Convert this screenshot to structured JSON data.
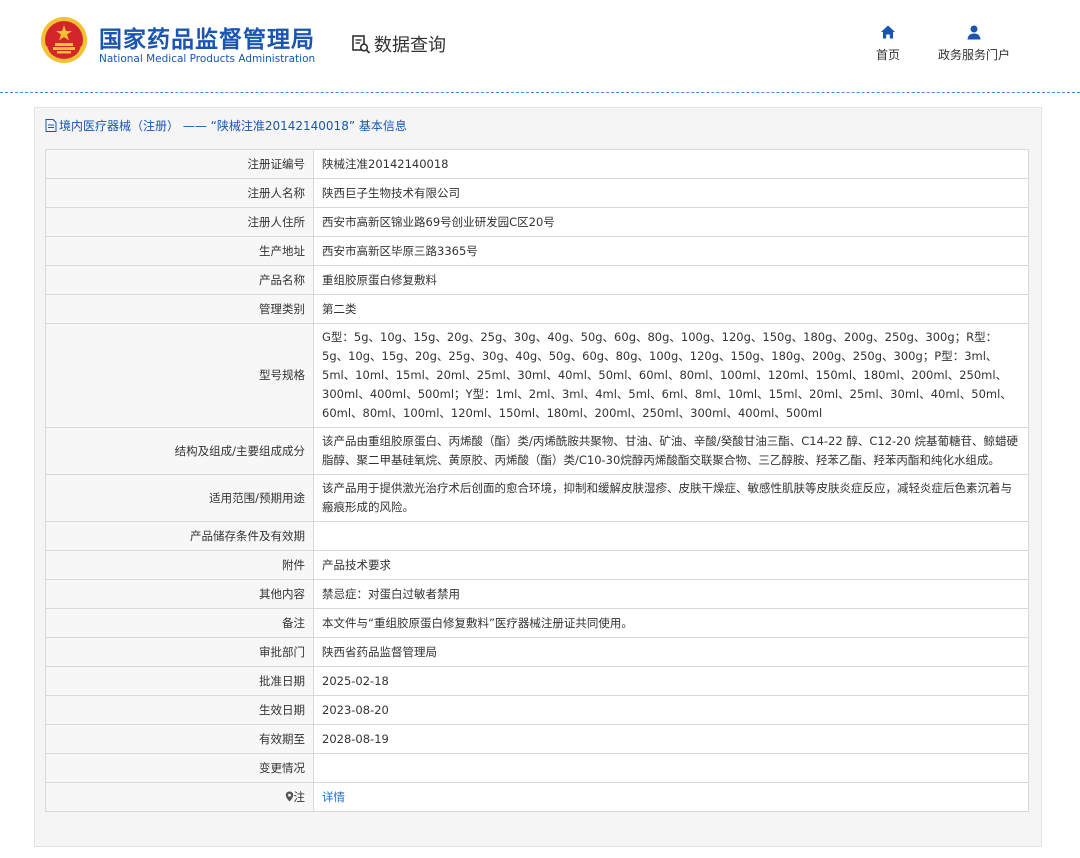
{
  "header": {
    "brand_cn": "国家药品监督管理局",
    "brand_en": "National Medical Products Administration",
    "emblem_icon": "national-emblem-icon",
    "query_icon": "document-search-icon",
    "query_label": "数据查询",
    "nav": [
      {
        "label": "首页",
        "icon": "home-icon"
      },
      {
        "label": "政务服务门户",
        "icon": "user-icon"
      }
    ]
  },
  "colors": {
    "brand_blue": "#1a56b0",
    "link_blue": "#1a6fd0",
    "panel_bg": "#f5f5f5",
    "emblem_red": "#d3252b",
    "emblem_gold": "#f2c230"
  },
  "panel": {
    "title": "境内医疗器械（注册） —— “陕械注准20142140018” 基本信息",
    "title_icon": "document-icon"
  },
  "rows": {
    "reg_no": {
      "label": "注册证编号",
      "value": "陕械注准20142140018"
    },
    "registrant": {
      "label": "注册人名称",
      "value": "陕西巨子生物技术有限公司"
    },
    "address": {
      "label": "注册人住所",
      "value": "西安市高新区锦业路69号创业研发园C区20号"
    },
    "mfg_address": {
      "label": "生产地址",
      "value": "西安市高新区毕原三路3365号"
    },
    "product_name": {
      "label": "产品名称",
      "value": "重组胶原蛋白修复敷料"
    },
    "category": {
      "label": "管理类别",
      "value": "第二类"
    },
    "model": {
      "label": "型号规格",
      "value": "G型：5g、10g、15g、20g、25g、30g、40g、50g、60g、80g、100g、120g、150g、180g、200g、250g、300g；R型：5g、10g、15g、20g、25g、30g、40g、50g、60g、80g、100g、120g、150g、180g、200g、250g、300g；P型：3ml、5ml、10ml、15ml、20ml、25ml、30ml、40ml、50ml、60ml、80ml、100ml、120ml、150ml、180ml、200ml、250ml、300ml、400ml、500ml；Y型：1ml、2ml、3ml、4ml、5ml、6ml、8ml、10ml、15ml、20ml、25ml、30ml、40ml、50ml、60ml、80ml、100ml、120ml、150ml、180ml、200ml、250ml、300ml、400ml、500ml"
    },
    "composition": {
      "label": "结构及组成/主要组成成分",
      "value": "该产品由重组胶原蛋白、丙烯酸（酯）类/丙烯酰胺共聚物、甘油、矿油、辛酸/癸酸甘油三酯、C14-22 醇、C12-20 烷基葡糖苷、鲸蜡硬脂醇、聚二甲基硅氧烷、黄原胶、丙烯酸（酯）类/C10-30烷醇丙烯酸酯交联聚合物、三乙醇胺、羟苯乙酯、羟苯丙酯和纯化水组成。"
    },
    "usage": {
      "label": "适用范围/预期用途",
      "value": "该产品用于提供激光治疗术后创面的愈合环境，抑制和缓解皮肤湿疹、皮肤干燥症、敏感性肌肤等皮肤炎症反应，减轻炎症后色素沉着与瘢痕形成的风险。"
    },
    "storage": {
      "label": "产品储存条件及有效期",
      "value": ""
    },
    "attachment": {
      "label": "附件",
      "value": "产品技术要求"
    },
    "other": {
      "label": "其他内容",
      "value": "禁忌症：对蛋白过敏者禁用"
    },
    "remark": {
      "label": "备注",
      "value": "本文件与“重组胶原蛋白修复敷料”医疗器械注册证共同使用。"
    },
    "approver": {
      "label": "审批部门",
      "value": "陕西省药品监督管理局"
    },
    "approval_date": {
      "label": "批准日期",
      "value": "2025-02-18"
    },
    "effective_date": {
      "label": "生效日期",
      "value": "2023-08-20"
    },
    "expiry_date": {
      "label": "有效期至",
      "value": "2028-08-19"
    },
    "changes": {
      "label": "变更情况",
      "value": ""
    },
    "note": {
      "label": "注",
      "icon": "pin-icon",
      "value": "详情"
    }
  }
}
